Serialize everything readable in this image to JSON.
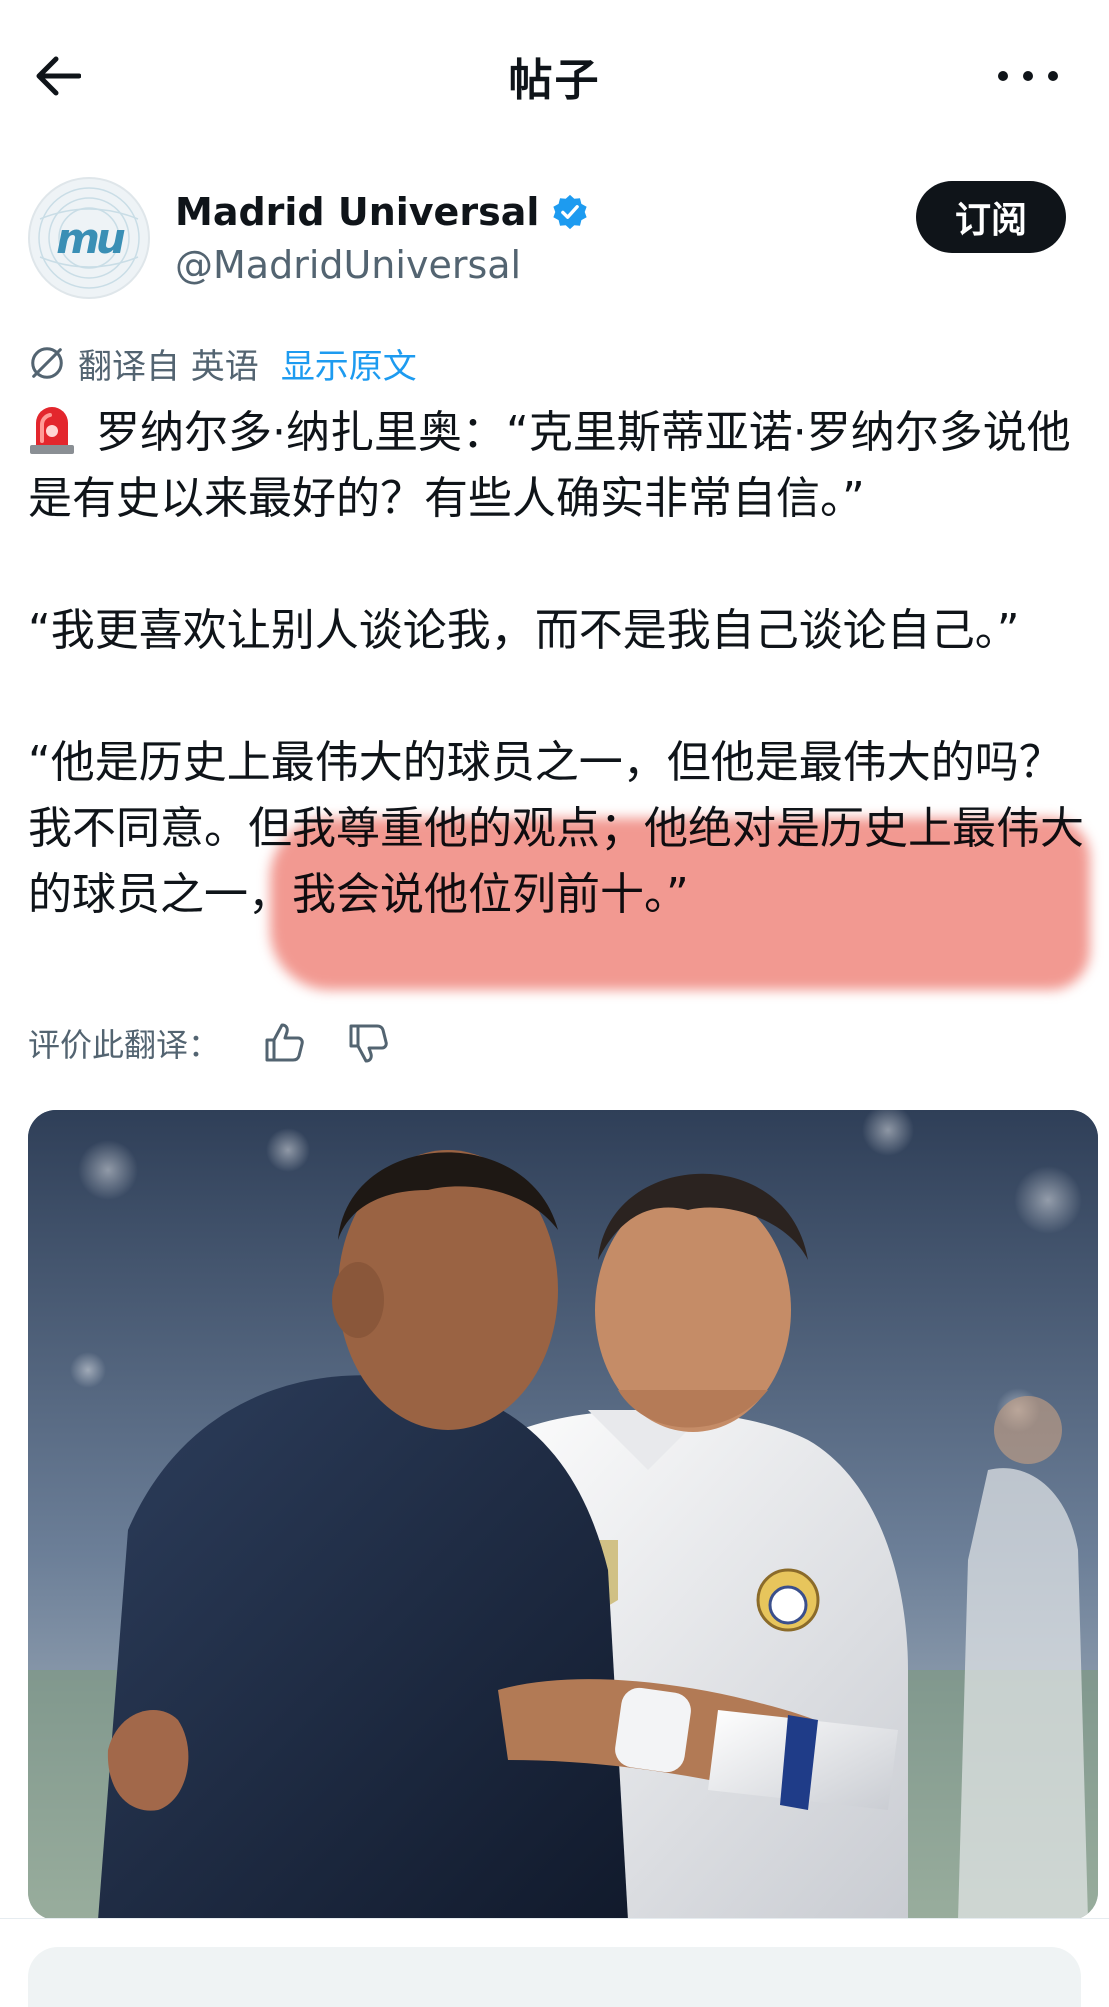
{
  "header": {
    "title": "帖子"
  },
  "author": {
    "display_name": "Madrid Universal",
    "handle": "@MadridUniversal",
    "avatar_text": "mu",
    "subscribe_label": "订阅"
  },
  "translation": {
    "translated_from": "翻译自 英语",
    "show_original": "显示原文",
    "rate_label": "评价此翻译："
  },
  "post": {
    "paragraphs": [
      "罗纳尔多·纳扎里奥：“克里斯蒂亚诺·罗纳尔多说他是有史以来最好的？有些人确实非常自信。”",
      "“我更喜欢让别人谈论我，而不是我自己谈论自己。”",
      "“他是历史上最伟大的球员之一，但他是最伟大的吗？我不同意。但我尊重他的观点；他绝对是历史上最伟大的球员之一，我会说他位列前十。”"
    ]
  },
  "colors": {
    "accent": "#1d9bf0",
    "text": "#0f1419",
    "muted": "#536471",
    "button_bg": "#0f1419",
    "highlight": "#e84637"
  },
  "icons": {
    "back": "arrow-left-icon",
    "more": "more-horizontal-icon",
    "verified": "verified-badge-icon",
    "translate": "translate-icon",
    "siren": "siren-emoji",
    "thumbs_up": "thumbs-up-icon",
    "thumbs_down": "thumbs-down-icon"
  }
}
